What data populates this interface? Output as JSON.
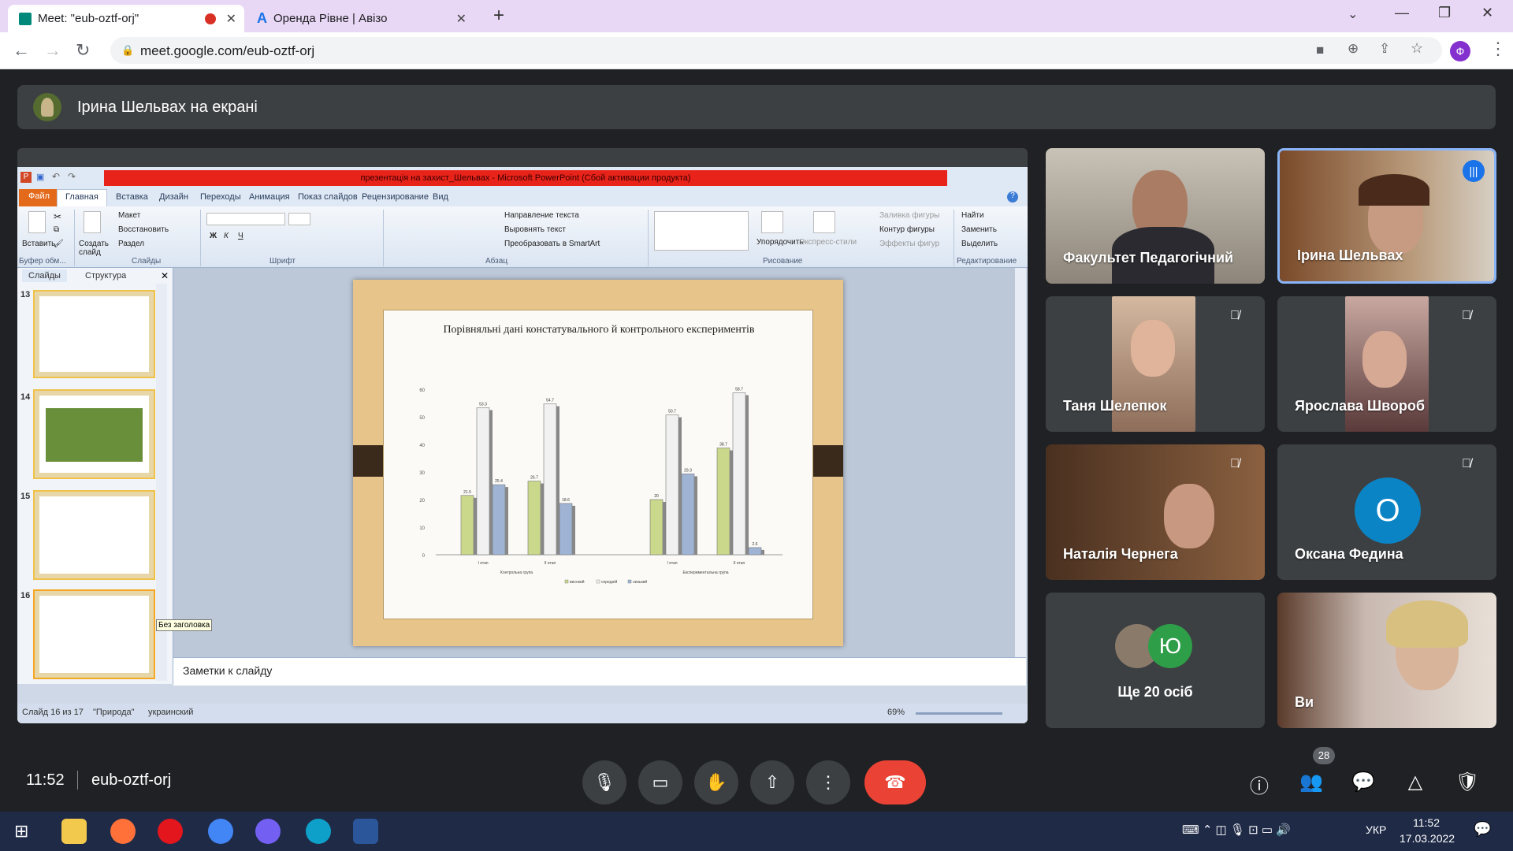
{
  "browser": {
    "tabs": [
      {
        "title": "Meet: \"eub-oztf-orj\""
      },
      {
        "title": "Оренда Рівне | Авізо"
      }
    ],
    "url": "meet.google.com/eub-oztf-orj",
    "profile_initial": "Ф"
  },
  "meet": {
    "banner": "Ірина Шельвах на екрані",
    "time": "11:52",
    "meeting_code": "eub-oztf-orj",
    "people_count": "28",
    "tiles": [
      {
        "name": "Факультет Педагогічний"
      },
      {
        "name": "Ірина Шельвах"
      },
      {
        "name": "Таня Шелепюк"
      },
      {
        "name": "Ярослава Швороб"
      },
      {
        "name": "Наталія Чернега"
      },
      {
        "name": "Оксана Федина",
        "initial": "О"
      },
      {
        "name": "Ще 20 осіб",
        "initial": "Ю"
      },
      {
        "name": "Ви"
      }
    ]
  },
  "ppt": {
    "title": "презентація на захист_Шельвах - Microsoft PowerPoint (Сбой активации продукта)",
    "menu": [
      "Файл",
      "Главная",
      "Вставка",
      "Дизайн",
      "Переходы",
      "Анимация",
      "Показ слайдов",
      "Рецензирование",
      "Вид"
    ],
    "ribbon": {
      "paste": "Вставить",
      "create_slide": "Создать слайд",
      "layout": "Макет",
      "restore": "Восстановить",
      "section": "Раздел",
      "text_direction": "Направление текста",
      "align_text": "Выровнять текст",
      "smartart": "Преобразовать в SmartArt",
      "arrange": "Упорядочить",
      "quick_styles": "Экспресс-стили",
      "fill": "Заливка фигуры",
      "outline": "Контур фигуры",
      "effects": "Эффекты фигур",
      "find": "Найти",
      "replace": "Заменить",
      "select": "Выделить",
      "groups": [
        "Буфер обм...",
        "Слайды",
        "Шрифт",
        "Абзац",
        "Рисование",
        "Редактирование"
      ]
    },
    "pane_tabs": [
      "Слайды",
      "Структура"
    ],
    "slide_numbers": [
      "13",
      "14",
      "15",
      "16"
    ],
    "tooltip": "Без заголовка",
    "notes": "Заметки к слайду",
    "status": {
      "slide": "Слайд 16 из 17",
      "theme": "\"Природа\"",
      "lang": "украинский",
      "zoom": "69%"
    }
  },
  "chart_data": {
    "type": "bar",
    "title": "Порівняльні дані констатувального й контрольного експериментів",
    "ylim": [
      0,
      60
    ],
    "yticks": [
      0,
      10,
      20,
      30,
      40,
      50,
      60
    ],
    "categories": [
      "I етап",
      "II етап",
      "I етап",
      "II етап"
    ],
    "groups": [
      "Контрольна група",
      "Експериментальна група"
    ],
    "series": [
      {
        "name": "високий",
        "values": [
          21.5,
          26.7,
          20,
          38.7
        ],
        "color": "#c9d88a"
      },
      {
        "name": "середній",
        "values": [
          53.3,
          54.7,
          50.7,
          58.7
        ],
        "color": "#f1f1f1"
      },
      {
        "name": "низький",
        "values": [
          25.4,
          18.6,
          29.3,
          2.6
        ],
        "color": "#9fb4d4"
      }
    ],
    "value_labels": [
      "21.5",
      "53.3",
      "25.4",
      "26.7",
      "54.7",
      "18.6",
      "20",
      "50.7",
      "29.3",
      "38.7",
      "58.7",
      "2.6"
    ]
  },
  "taskbar": {
    "lang": "УКР",
    "time": "11:52",
    "date": "17.03.2022"
  }
}
